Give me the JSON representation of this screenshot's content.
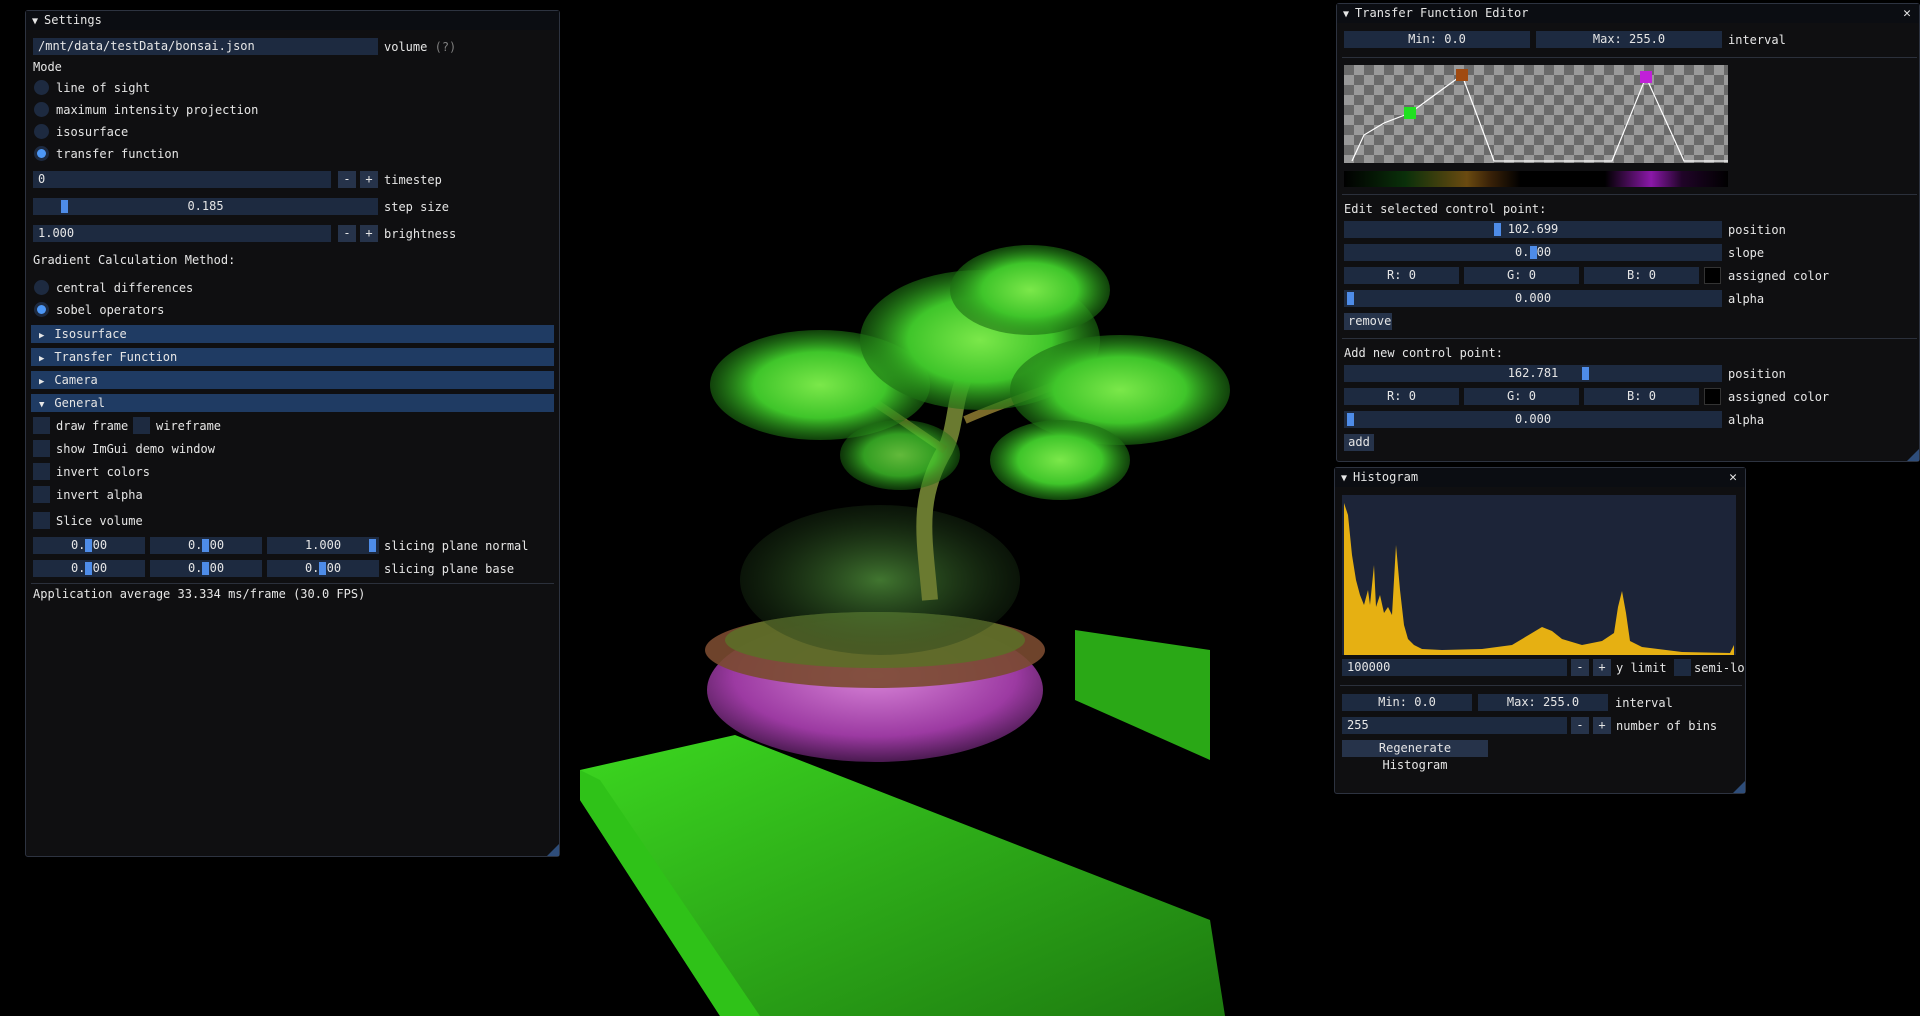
{
  "settings": {
    "title": "Settings",
    "file_path": "/mnt/data/testData/bonsai.json",
    "volume_label": "volume",
    "help_marker": "(?)",
    "mode_label": "Mode",
    "modes": [
      "line of sight",
      "maximum intensity projection",
      "isosurface",
      "transfer function"
    ],
    "mode_selected": "transfer function",
    "timestep_value": "0",
    "timestep_label": "timestep",
    "step_size_value": "0.185",
    "step_size_fraction": 0.07,
    "step_size_label": "step size",
    "brightness_value": "1.000",
    "brightness_label": "brightness",
    "minus": "-",
    "plus": "+",
    "gradient_label": "Gradient Calculation Method:",
    "gradient_methods": [
      "central differences",
      "sobel operators"
    ],
    "gradient_selected": "sobel operators",
    "headers": [
      "Isosurface",
      "Transfer Function",
      "Camera",
      "General"
    ],
    "general": {
      "draw_frame": "draw frame",
      "wireframe": "wireframe",
      "show_demo": "show ImGui demo window",
      "invert_colors": "invert colors",
      "invert_alpha": "invert alpha",
      "slice_volume": "Slice volume",
      "normal_values": [
        "0.000",
        "0.000",
        "1.000"
      ],
      "normal_label": "slicing plane normal",
      "base_values": [
        "0.000",
        "0.000",
        "0.000"
      ],
      "base_label": "slicing plane base"
    },
    "app_average": "Application average 33.334 ms/frame (30.0 FPS)"
  },
  "tf_editor": {
    "title": "Transfer Function Editor",
    "min": "Min: 0.0",
    "max": "Max: 255.0",
    "interval_label": "interval",
    "edit_label": "Edit selected control point:",
    "edit_position": "102.699",
    "edit_position_fraction": 0.4,
    "position_label": "position",
    "edit_slope": "0.000",
    "slope_label": "slope",
    "r": "R: 0",
    "g": "G: 0",
    "b": "B: 0",
    "assigned_color_label": "assigned color",
    "edit_alpha": "0.000",
    "alpha_label": "alpha",
    "remove": "remove",
    "add_label": "Add new control point:",
    "add_position": "162.781",
    "add_position_fraction": 0.64,
    "add_alpha": "0.000",
    "add": "add",
    "control_point_colors": [
      "#20e020",
      "#a04a10",
      "#c020d8"
    ]
  },
  "histogram": {
    "title": "Histogram",
    "y_limit_value": "100000",
    "y_limit_label": "y limit",
    "semilog_label": "semi-lo",
    "min": "Min: 0.0",
    "max": "Max: 255.0",
    "interval_label": "interval",
    "bins_value": "255",
    "bins_label": "number of bins",
    "regenerate": "Regenerate Histogram",
    "fill_color": "#e6b012",
    "bg_color": "#1c2438"
  },
  "colors": {
    "accent": "#4d97f5",
    "header": "#1f3b63",
    "volume_green": "#3ee02a",
    "volume_magenta": "#c050c8"
  }
}
